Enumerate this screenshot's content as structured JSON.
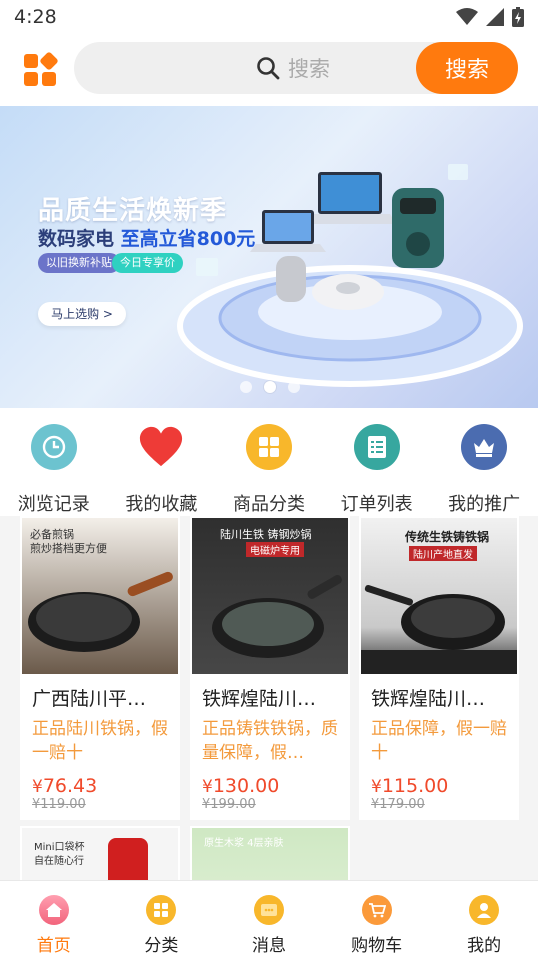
{
  "status_bar": {
    "time": "4:28"
  },
  "header": {
    "search_placeholder": "搜索",
    "search_button": "搜索"
  },
  "banner": {
    "title": "品质生活焕新季",
    "subtitle_prefix": "数码家电 ",
    "subtitle_accent": "至高立省800元",
    "tag1": "以旧换新补贴",
    "tag2": "今日专享价",
    "button": "马上选购 >",
    "active_dot": 1
  },
  "quick_nav": [
    {
      "label": "浏览记录",
      "icon": "clock-icon",
      "color": "#6cc3cf"
    },
    {
      "label": "我的收藏",
      "icon": "heart-icon",
      "color": "#ee3b37"
    },
    {
      "label": "商品分类",
      "icon": "grid-icon",
      "color": "#f8b72b"
    },
    {
      "label": "订单列表",
      "icon": "clipboard-icon",
      "color": "#37a79f"
    },
    {
      "label": "我的推广",
      "icon": "crown-icon",
      "color": "#4b6cb0"
    }
  ],
  "products": [
    {
      "name": "广西陆川平…",
      "desc": "正品陆川铁锅，假一赔十",
      "price_symbol": "¥",
      "price": "76.43",
      "old_price": "¥119.00",
      "img_text1": "必备煎锅",
      "img_text2": "煎炒搭档更方便"
    },
    {
      "name": "铁辉煌陆川…",
      "desc": "正品铸铁铁锅，质量保障，假…",
      "price_symbol": "¥",
      "price": "130.00",
      "old_price": "¥199.00",
      "img_text1": "陆川生铁 铸钢炒锅",
      "img_text2": "电磁炉专用"
    },
    {
      "name": "铁辉煌陆川…",
      "desc": "正品保障，假一赔十",
      "price_symbol": "¥",
      "price": "115.00",
      "old_price": "¥179.00",
      "img_text1": "传统生铁铸铁锅",
      "img_text2": "陆川产地直发"
    },
    {
      "name": "",
      "img_text1": "Mini口袋杯",
      "img_text2": "自在随心行"
    },
    {
      "name": "",
      "img_text1": "原生木浆 4层亲肤",
      "img_text2": ""
    }
  ],
  "tabbar": [
    {
      "label": "首页",
      "icon": "home-icon",
      "active": true
    },
    {
      "label": "分类",
      "icon": "category-icon",
      "active": false
    },
    {
      "label": "消息",
      "icon": "message-icon",
      "active": false
    },
    {
      "label": "购物车",
      "icon": "cart-icon",
      "active": false
    },
    {
      "label": "我的",
      "icon": "user-icon",
      "active": false
    }
  ],
  "colors": {
    "accent": "#ff7a0e",
    "price": "#f04a2b",
    "desc": "#f39a3c"
  }
}
